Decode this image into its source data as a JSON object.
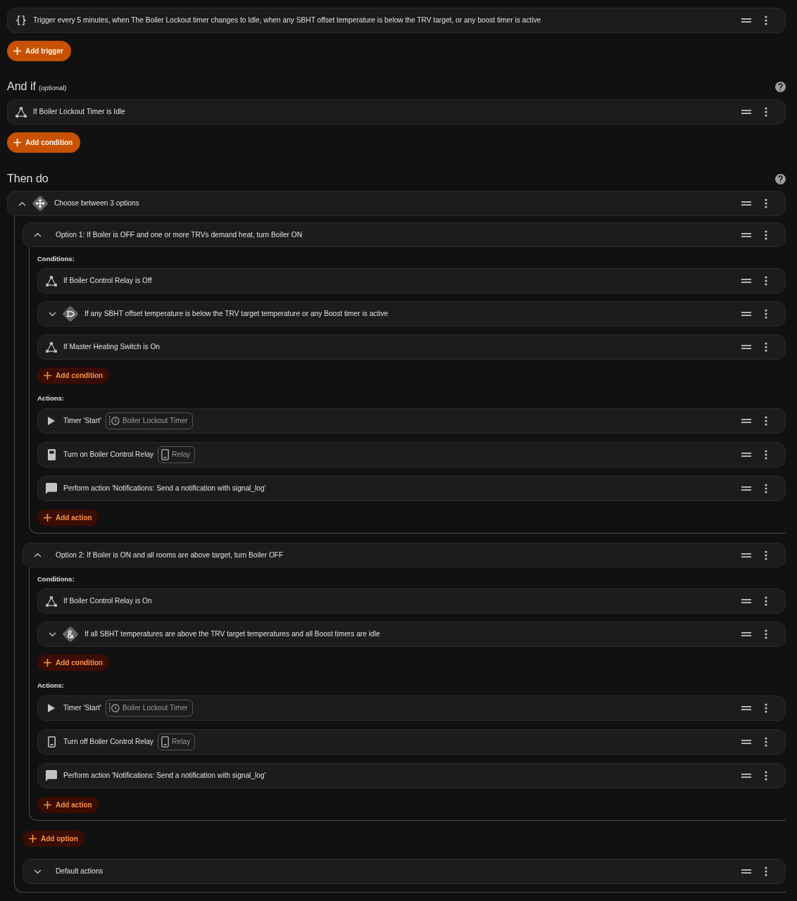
{
  "triggers": {
    "items": [
      {
        "kind": "template",
        "text": "Trigger every 5 minutes, when The Boiler Lockout timer changes to Idle, when any SBHT offset temperature is below the TRV target, or any boost timer is active"
      }
    ],
    "add_button": "Add trigger"
  },
  "conditions": {
    "title": "And if",
    "note": "(optional)",
    "items": [
      {
        "kind": "state",
        "text": "If Boiler Lockout Timer is Idle"
      }
    ],
    "add_button": "Add condition"
  },
  "actions": {
    "title": "Then do",
    "items": [
      {
        "kind": "choose",
        "text": "Choose between 3 options",
        "expanded": true,
        "options": [
          {
            "title": "Option 1: If Boiler is OFF and one or more TRVs demand heat, turn Boiler ON",
            "expanded": true,
            "conditions_label": "Conditions:",
            "conditions": [
              {
                "kind": "state",
                "text": "If Boiler Control Relay is Off"
              },
              {
                "kind": "or",
                "text": "If any SBHT offset temperature is below the TRV target temperature or any Boost timer is active",
                "expanded": false
              },
              {
                "kind": "state",
                "text": "If Master Heating Switch is On"
              }
            ],
            "add_condition": "Add condition",
            "actions_label": "Actions:",
            "actions": [
              {
                "kind": "timer",
                "text": "Timer 'Start'",
                "chip": {
                  "kind": "timer",
                  "text": "Boiler Lockout Timer"
                }
              },
              {
                "kind": "switch_on",
                "text": "Turn on Boiler Control Relay",
                "chip": {
                  "kind": "switch",
                  "text": "Relay"
                }
              },
              {
                "kind": "notify",
                "text": "Perform action 'Notifications: Send a notification with signal_log'"
              }
            ],
            "add_action": "Add action"
          },
          {
            "title": "Option 2: If Boiler is ON and all rooms are above target, turn Boiler OFF",
            "expanded": true,
            "conditions_label": "Conditions:",
            "conditions": [
              {
                "kind": "state",
                "text": "If Boiler Control Relay is On"
              },
              {
                "kind": "and",
                "text": "If all SBHT temperatures are above the TRV target temperatures and all Boost timers are idle",
                "expanded": false
              }
            ],
            "add_condition": "Add condition",
            "actions_label": "Actions:",
            "actions": [
              {
                "kind": "timer",
                "text": "Timer 'Start'",
                "chip": {
                  "kind": "timer",
                  "text": "Boiler Lockout Timer"
                }
              },
              {
                "kind": "switch_off",
                "text": "Turn off Boiler Control Relay",
                "chip": {
                  "kind": "switch",
                  "text": "Relay"
                }
              },
              {
                "kind": "notify",
                "text": "Perform action 'Notifications: Send a notification with signal_log'"
              }
            ],
            "add_action": "Add action"
          }
        ],
        "add_option": "Add option",
        "default": {
          "title": "Default actions",
          "expanded": false
        }
      }
    ]
  }
}
